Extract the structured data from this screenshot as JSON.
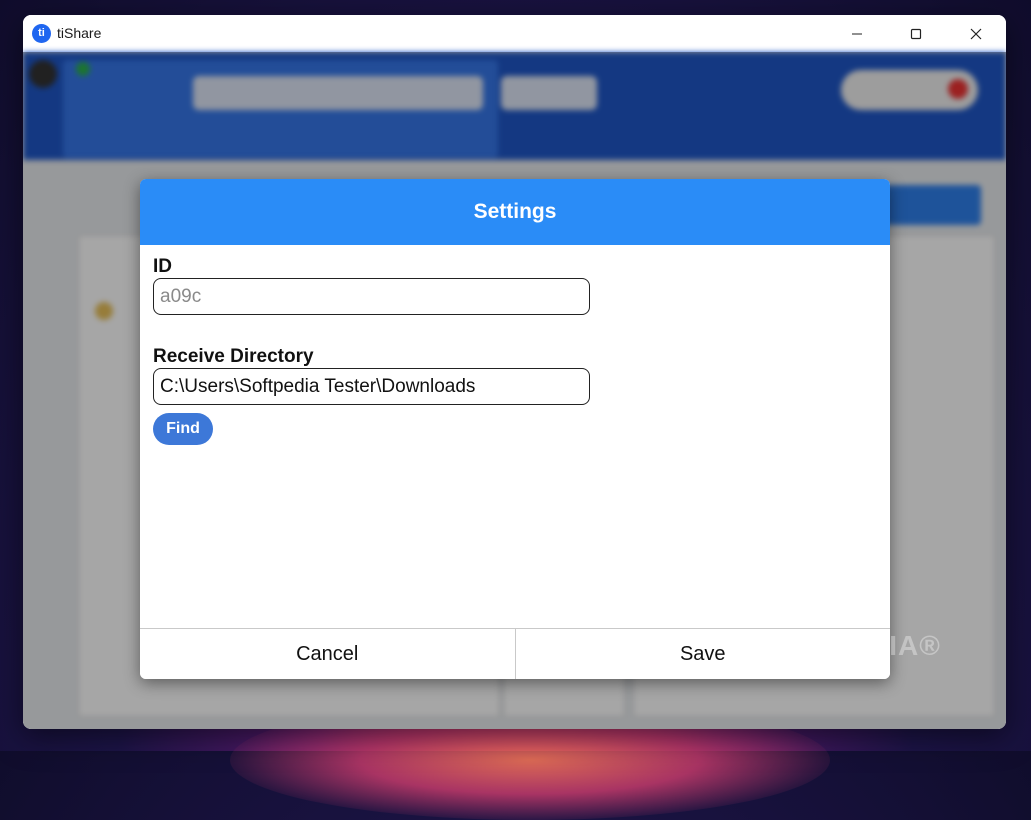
{
  "window": {
    "title": "tiShare",
    "logo_text": "ti",
    "controls": [
      "minimize-icon",
      "maximize-icon",
      "close-icon"
    ]
  },
  "colors": {
    "dialog_header": "#2a8cf7",
    "find_button": "#3d78d8",
    "app_header": "#1f57c8"
  },
  "dialog": {
    "title": "Settings",
    "id_label": "ID",
    "id_value": "a09c",
    "receive_dir_label": "Receive Directory",
    "receive_dir_value": "C:\\Users\\Softpedia Tester\\Downloads",
    "find_label": "Find",
    "cancel_label": "Cancel",
    "save_label": "Save"
  },
  "watermark": "SOFTPEDIA®"
}
